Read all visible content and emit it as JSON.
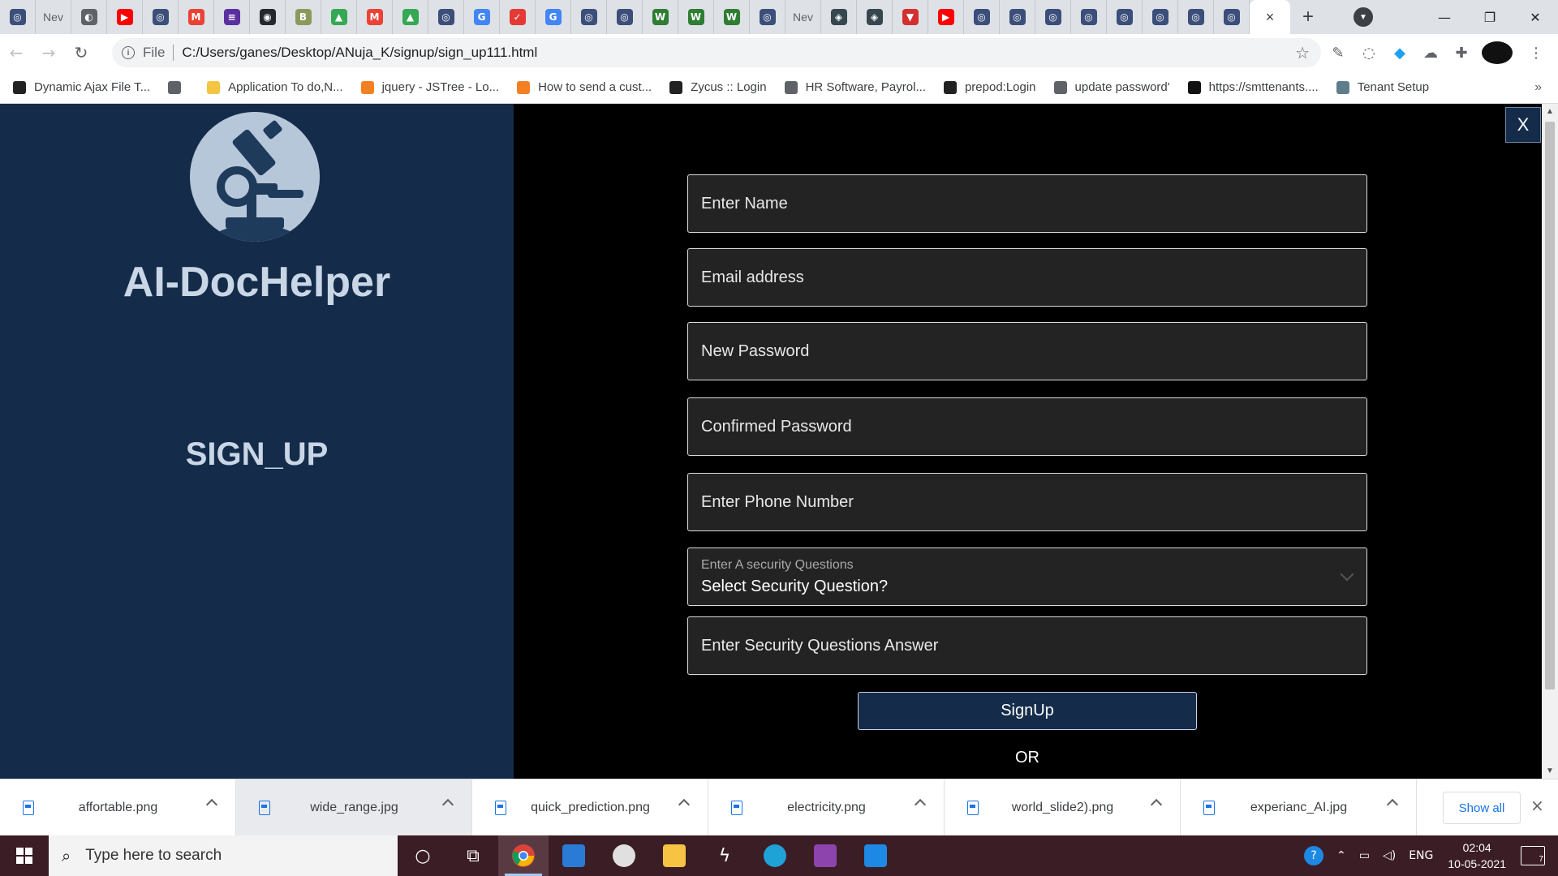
{
  "browser": {
    "tabs": [
      {
        "title": "",
        "color": "#3c4f7a",
        "glyph": "◎"
      },
      {
        "title": "Nev",
        "color": "",
        "glyph": ""
      },
      {
        "title": "",
        "color": "#5f6368",
        "glyph": "◐"
      },
      {
        "title": "",
        "color": "#ff0000",
        "glyph": "▶"
      },
      {
        "title": "",
        "color": "#3c4f7a",
        "glyph": "◎"
      },
      {
        "title": "",
        "color": "#ea4335",
        "glyph": "M"
      },
      {
        "title": "",
        "color": "#5b2fa0",
        "glyph": "≡"
      },
      {
        "title": "",
        "color": "#24292e",
        "glyph": "◉"
      },
      {
        "title": "",
        "color": "#8a9a5b",
        "glyph": "B"
      },
      {
        "title": "",
        "color": "#34a853",
        "glyph": "▲"
      },
      {
        "title": "",
        "color": "#ea4335",
        "glyph": "M"
      },
      {
        "title": "",
        "color": "#34a853",
        "glyph": "▲"
      },
      {
        "title": "",
        "color": "#3c4f7a",
        "glyph": "◎"
      },
      {
        "title": "",
        "color": "#4285f4",
        "glyph": "G"
      },
      {
        "title": "",
        "color": "#e53935",
        "glyph": "✓"
      },
      {
        "title": "",
        "color": "#4285f4",
        "glyph": "G"
      },
      {
        "title": "",
        "color": "#3c4f7a",
        "glyph": "◎"
      },
      {
        "title": "",
        "color": "#3c4f7a",
        "glyph": "◎"
      },
      {
        "title": "",
        "color": "#2e7d32",
        "glyph": "W"
      },
      {
        "title": "",
        "color": "#2e7d32",
        "glyph": "W"
      },
      {
        "title": "",
        "color": "#2e7d32",
        "glyph": "W"
      },
      {
        "title": "",
        "color": "#3c4f7a",
        "glyph": "◎"
      },
      {
        "title": "Nev",
        "color": "",
        "glyph": ""
      },
      {
        "title": "",
        "color": "#37474f",
        "glyph": "◈"
      },
      {
        "title": "",
        "color": "#37474f",
        "glyph": "◈"
      },
      {
        "title": "",
        "color": "#d32f2f",
        "glyph": "▼"
      },
      {
        "title": "",
        "color": "#ff0000",
        "glyph": "▶"
      },
      {
        "title": "",
        "color": "#3c4f7a",
        "glyph": "◎"
      },
      {
        "title": "",
        "color": "#3c4f7a",
        "glyph": "◎"
      },
      {
        "title": "",
        "color": "#3c4f7a",
        "glyph": "◎"
      },
      {
        "title": "",
        "color": "#3c4f7a",
        "glyph": "◎"
      },
      {
        "title": "",
        "color": "#3c4f7a",
        "glyph": "◎"
      },
      {
        "title": "",
        "color": "#3c4f7a",
        "glyph": "◎"
      },
      {
        "title": "",
        "color": "#3c4f7a",
        "glyph": "◎"
      },
      {
        "title": "",
        "color": "#3c4f7a",
        "glyph": "◎"
      }
    ],
    "active_tab_close": "×",
    "new_tab": "+",
    "url_scheme": "File",
    "url": "C:/Users/ganes/Desktop/ANuja_K/signup/sign_up111.html",
    "bookmarks": [
      {
        "label": "Dynamic Ajax File T...",
        "color": "#222"
      },
      {
        "label": "",
        "color": "#5f6368"
      },
      {
        "label": "Application To do,N...",
        "color": "#f4c542"
      },
      {
        "label": "jquery - JSTree - Lo...",
        "color": "#f48024"
      },
      {
        "label": "How to send a cust...",
        "color": "#f48024"
      },
      {
        "label": "Zycus :: Login",
        "color": "#222"
      },
      {
        "label": "HR Software, Payrol...",
        "color": "#5f6368"
      },
      {
        "label": "prepod:Login",
        "color": "#222"
      },
      {
        "label": "update password'",
        "color": "#5f6368"
      },
      {
        "label": "https://smttenants....",
        "color": "#111"
      },
      {
        "label": "Tenant Setup",
        "color": "#607d8b"
      }
    ],
    "bookmarks_more": "»"
  },
  "page": {
    "brand": "AI-DocHelper",
    "heading": "SIGN_UP",
    "close_label": "X",
    "fields": {
      "name_placeholder": "Enter Name",
      "email_placeholder": "Email address",
      "password_placeholder": "New Password",
      "confirm_placeholder": "Confirmed Password",
      "phone_placeholder": "Enter Phone Number",
      "security_label": "Enter A security Questions",
      "security_value": "Select Security Question?",
      "answer_placeholder": "Enter Security Questions Answer"
    },
    "signup_button": "SignUp",
    "or_text": "OR",
    "colors": {
      "left_panel": "#142c4a",
      "right_panel": "#000000",
      "field_bg": "#232323"
    }
  },
  "downloads": {
    "items": [
      "affortable.png",
      "wide_range.jpg",
      "quick_prediction.png",
      "electricity.png",
      "world_slide2).png",
      "experianc_AI.jpg"
    ],
    "show_all": "Show all",
    "close": "×"
  },
  "taskbar": {
    "search_placeholder": "Type here to search",
    "language": "ENG",
    "time": "02:04",
    "date": "10-05-2021",
    "notifications": "7"
  }
}
